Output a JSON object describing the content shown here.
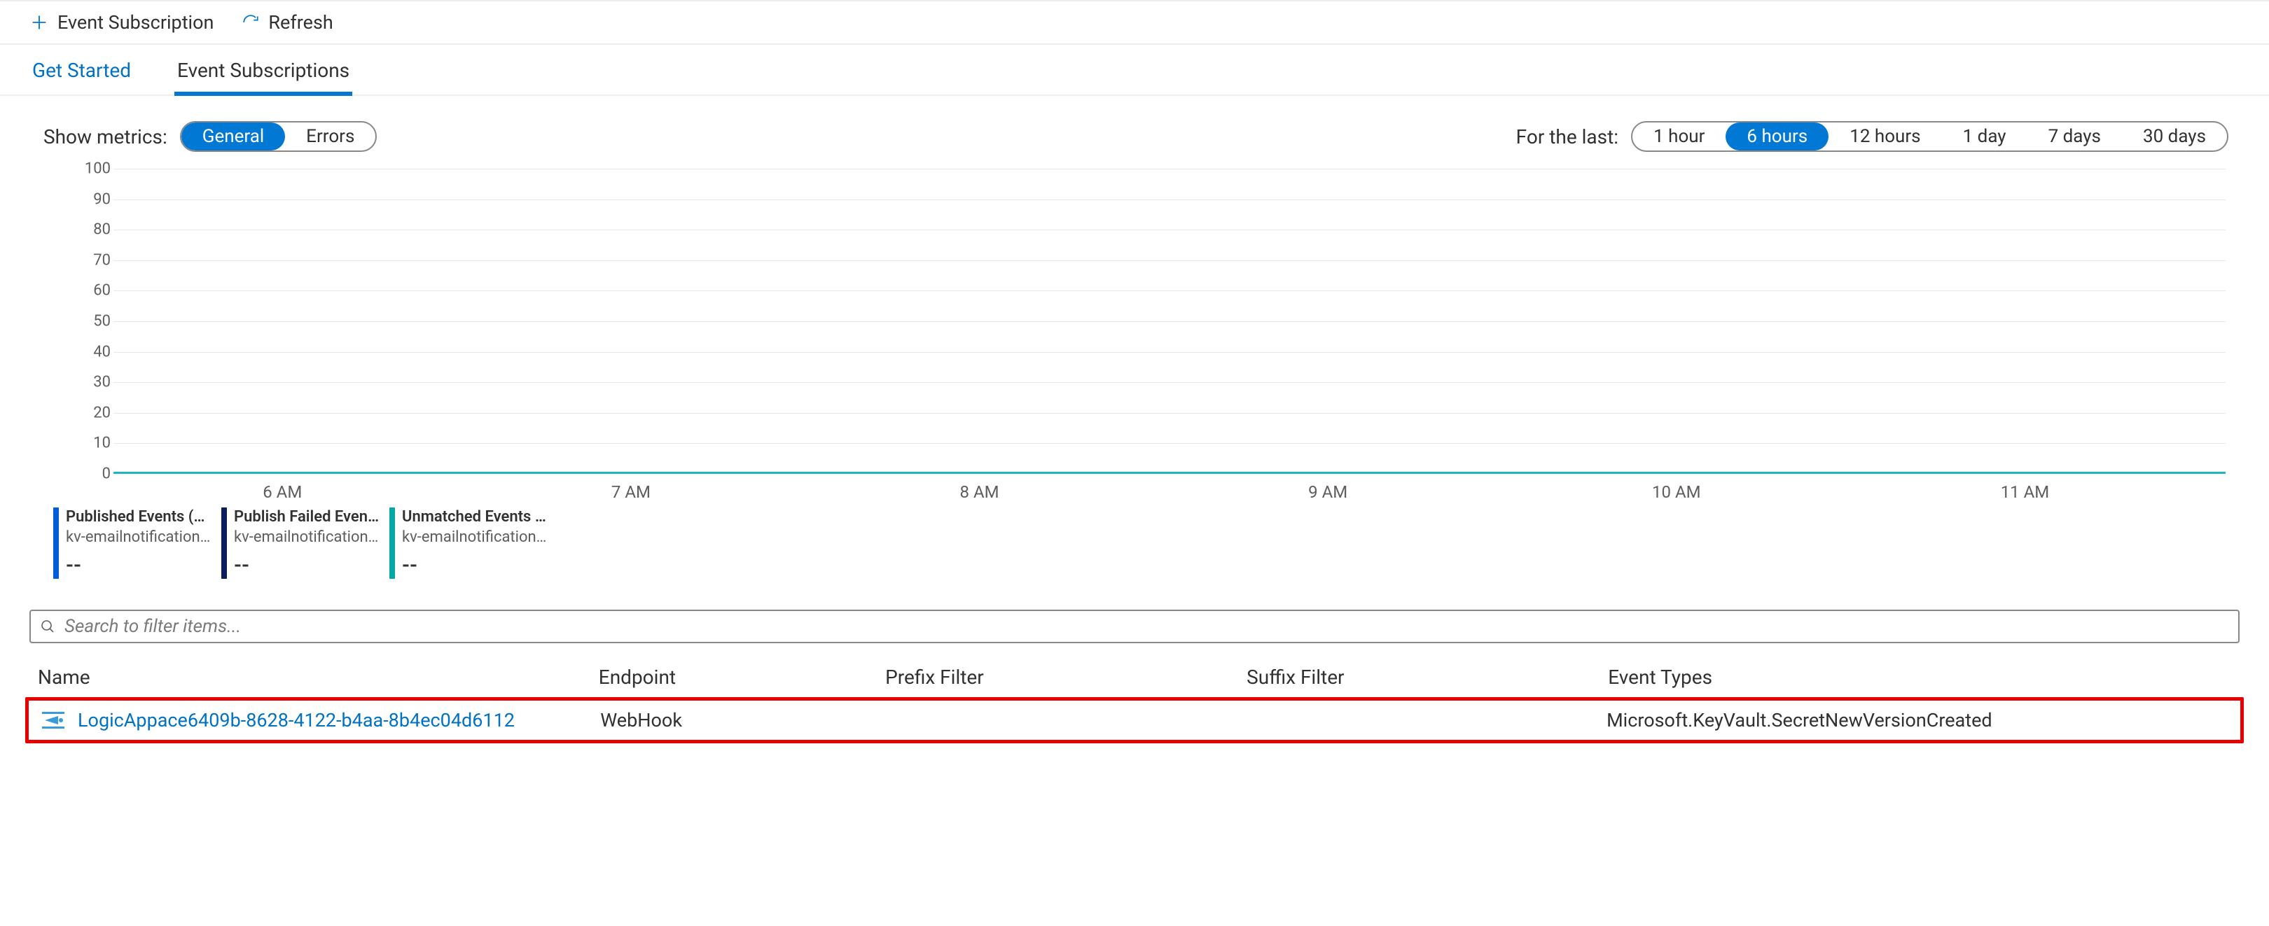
{
  "toolbar": {
    "new_sub": "Event Subscription",
    "refresh": "Refresh"
  },
  "tabs": {
    "get_started": "Get Started",
    "subs": "Event Subscriptions"
  },
  "metrics": {
    "label": "Show metrics:",
    "general": "General",
    "errors": "Errors"
  },
  "range": {
    "label": "For the last:",
    "h1": "1 hour",
    "h6": "6 hours",
    "h12": "12 hours",
    "d1": "1 day",
    "d7": "7 days",
    "d30": "30 days"
  },
  "chart_data": {
    "type": "line",
    "ylim": [
      0,
      100
    ],
    "yticks": [
      0,
      10,
      20,
      30,
      40,
      50,
      60,
      70,
      80,
      90,
      100
    ],
    "xticks": [
      "6 AM",
      "7 AM",
      "8 AM",
      "9 AM",
      "10 AM",
      "11 AM"
    ],
    "series": [
      {
        "name": "Published Events (Sum)",
        "source": "kv-emailnotification…",
        "color": "#015cda",
        "value": "--"
      },
      {
        "name": "Publish Failed Event…",
        "source": "kv-emailnotification…",
        "color": "#0b1d5b",
        "value": "--"
      },
      {
        "name": "Unmatched Events (Sum)",
        "source": "kv-emailnotification…",
        "color": "#05a7a7",
        "value": "--"
      }
    ],
    "flatline": 0
  },
  "search": {
    "placeholder": "Search to filter items..."
  },
  "table": {
    "headers": {
      "name": "Name",
      "endpoint": "Endpoint",
      "prefix": "Prefix Filter",
      "suffix": "Suffix Filter",
      "types": "Event Types"
    },
    "rows": [
      {
        "name": "LogicAppace6409b-8628-4122-b4aa-8b4ec04d6112",
        "endpoint": "WebHook",
        "prefix": "",
        "suffix": "",
        "types": "Microsoft.KeyVault.SecretNewVersionCreated"
      }
    ]
  }
}
